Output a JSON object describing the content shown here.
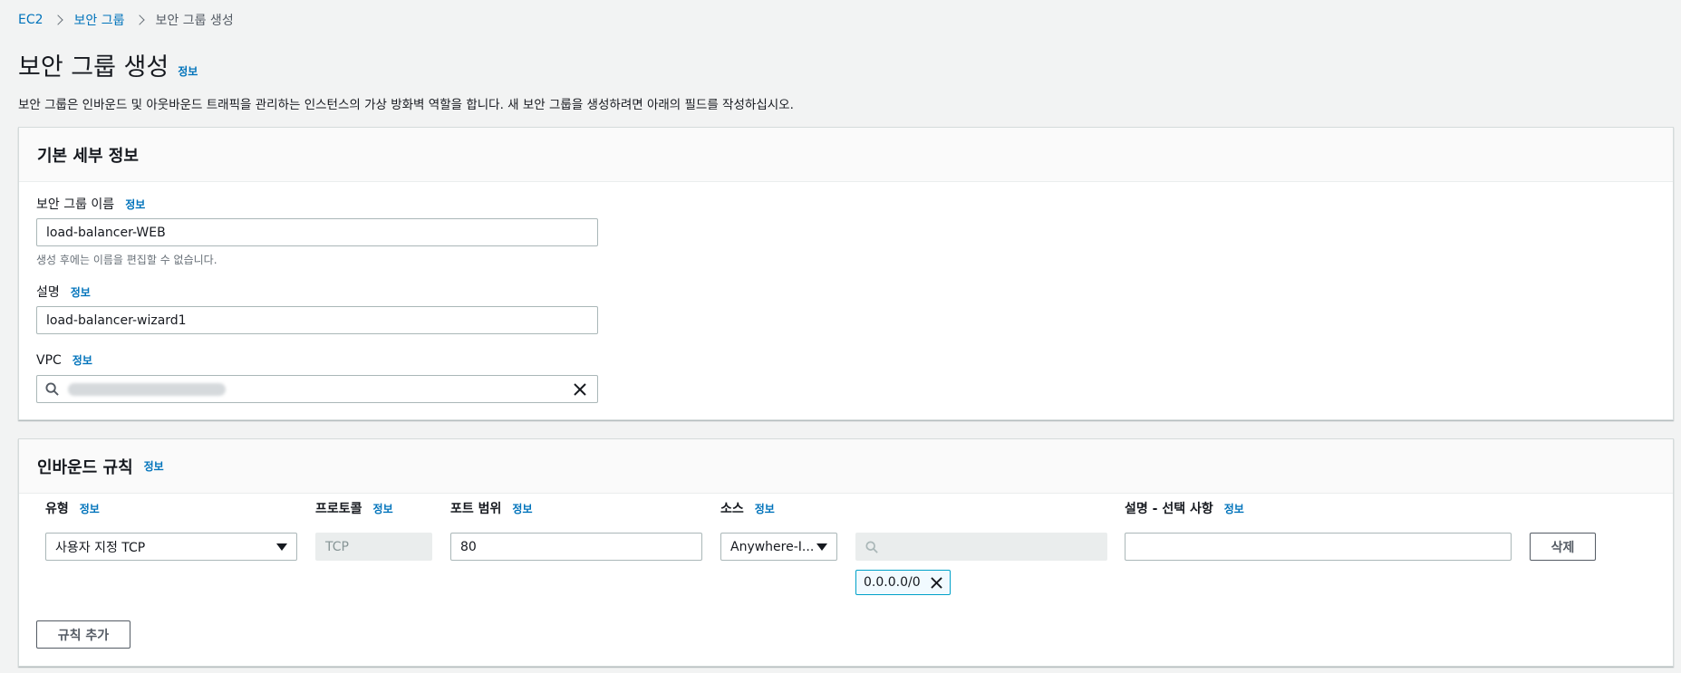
{
  "breadcrumb": {
    "items": [
      "EC2",
      "보안 그룹"
    ],
    "current": "보안 그룹 생성"
  },
  "page": {
    "title": "보안 그룹 생성",
    "info": "정보",
    "description": "보안 그룹은 인바운드 및 아웃바운드 트래픽을 관리하는 인스턴스의 가상 방화벽 역할을 합니다. 새 보안 그룹을 생성하려면 아래의 필드를 작성하십시오."
  },
  "basic": {
    "title": "기본 세부 정보",
    "name_label": "보안 그룹 이름",
    "name_info": "정보",
    "name_value": "load-balancer-WEB",
    "name_hint": "생성 후에는 이름을 편집할 수 없습니다.",
    "desc_label": "설명",
    "desc_info": "정보",
    "desc_value": "load-balancer-wizard1",
    "vpc_label": "VPC",
    "vpc_info": "정보"
  },
  "inbound": {
    "title": "인바운드 규칙",
    "info": "정보",
    "columns": {
      "type": "유형",
      "protocol": "프로토콜",
      "port": "포트 범위",
      "source": "소스",
      "description": "설명 - 선택 사항",
      "info": "정보"
    },
    "rule": {
      "type": "사용자 지정 TCP",
      "protocol": "TCP",
      "port": "80",
      "source": "Anywhere-I...",
      "cidr": "0.0.0.0/0",
      "description": ""
    },
    "delete_label": "삭제",
    "add_rule_label": "규칙 추가"
  },
  "colors": {
    "link": "#0073bb",
    "token_border": "#00a1c9"
  }
}
